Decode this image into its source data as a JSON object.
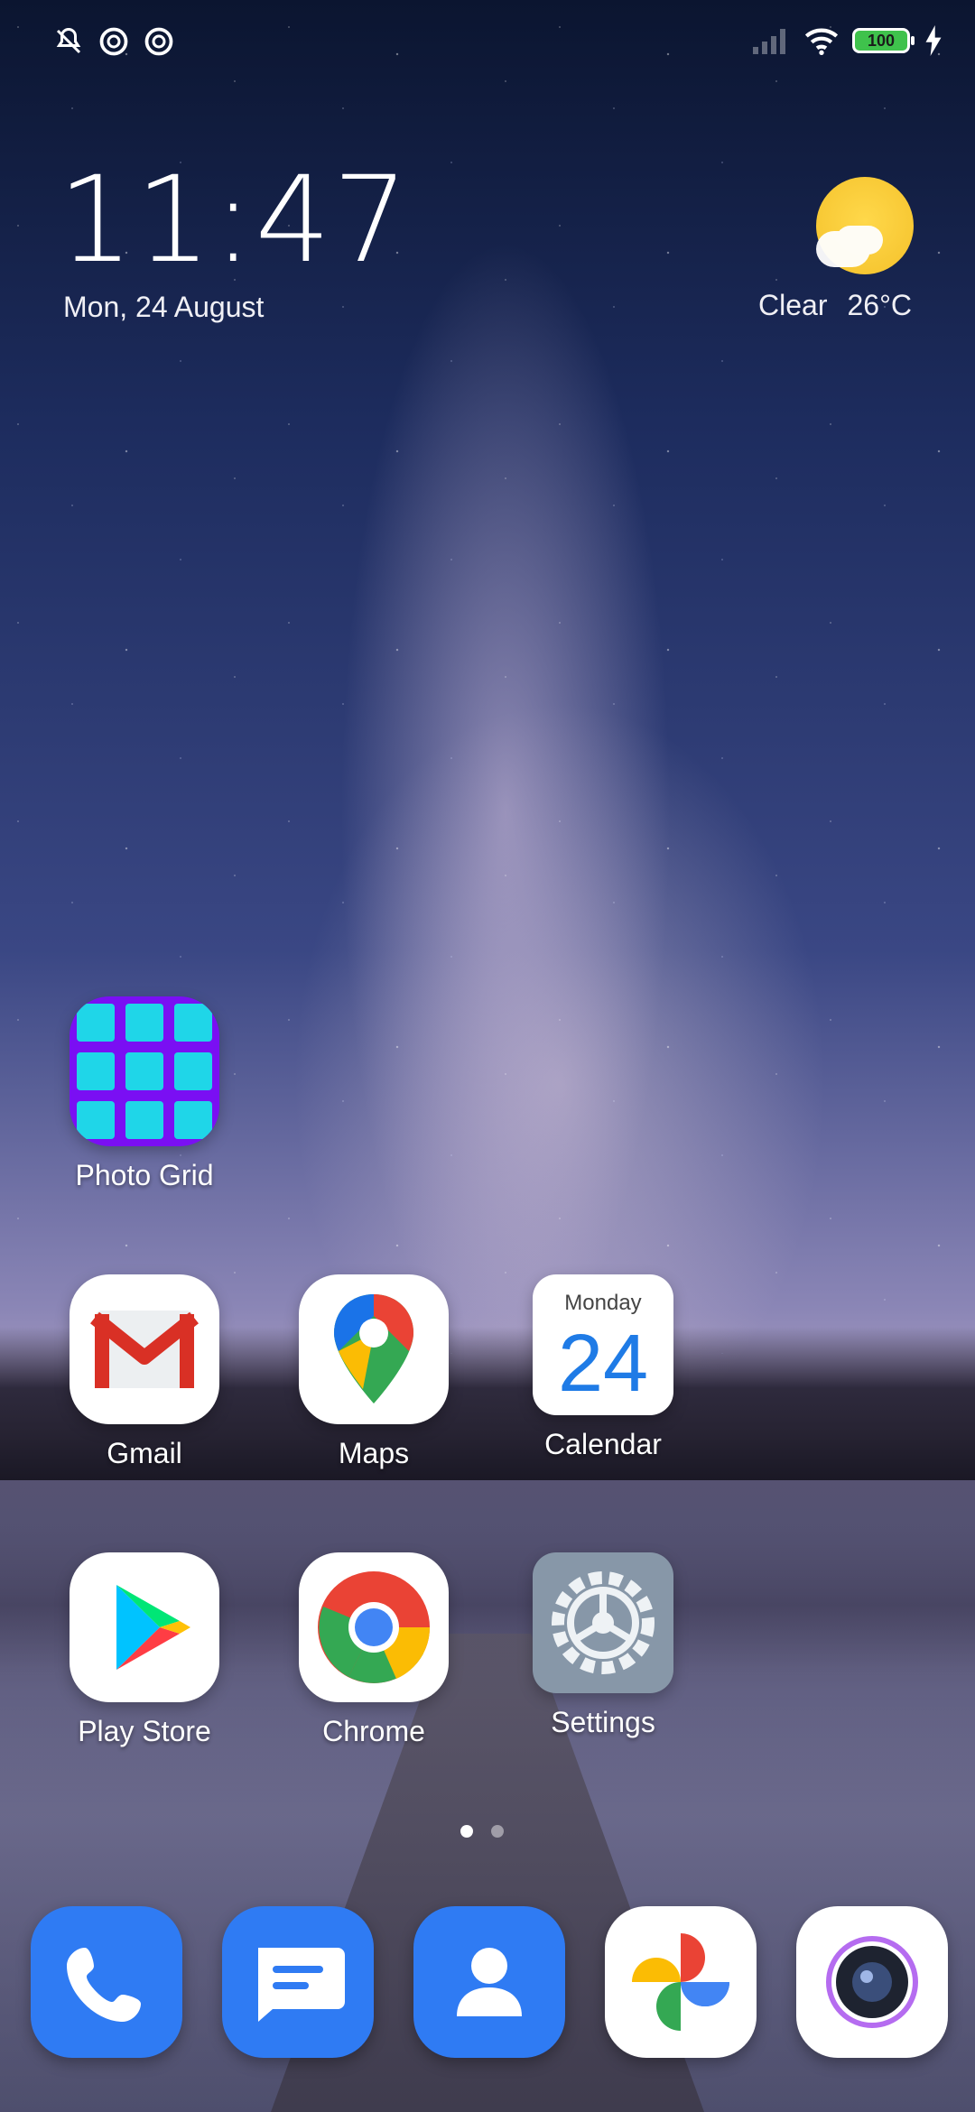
{
  "status_bar": {
    "battery": "100",
    "icons_left": [
      "mute-notifications-icon",
      "data-saver-icon",
      "data-saver-icon"
    ],
    "icons_right": [
      "signal-icon",
      "wifi-icon",
      "battery-icon",
      "charging-icon"
    ]
  },
  "clock_widget": {
    "time": "11:47",
    "date": "Mon, 24 August"
  },
  "weather_widget": {
    "condition": "Clear",
    "temperature": "26°C",
    "icon": "partly-sunny-icon"
  },
  "home_apps": [
    {
      "label": "Photo Grid",
      "icon": "photo-grid-icon"
    },
    {
      "label": "Gmail",
      "icon": "gmail-icon"
    },
    {
      "label": "Maps",
      "icon": "maps-icon"
    },
    {
      "label": "Calendar",
      "icon": "calendar-icon",
      "badge_day": "Monday",
      "badge_num": "24"
    },
    {
      "label": "Play Store",
      "icon": "play-store-icon"
    },
    {
      "label": "Chrome",
      "icon": "chrome-icon"
    },
    {
      "label": "Settings",
      "icon": "settings-icon"
    }
  ],
  "page_indicator": {
    "pages": 2,
    "current": 1
  },
  "dock": [
    {
      "icon": "phone-icon"
    },
    {
      "icon": "messages-icon"
    },
    {
      "icon": "contacts-icon"
    },
    {
      "icon": "photos-icon"
    },
    {
      "icon": "camera-icon"
    }
  ],
  "colors": {
    "accent_blue": "#2f7bf3",
    "calendar_blue": "#1f7be6",
    "battery_green": "#3fc24c",
    "sun_yellow": "#f4c12a"
  }
}
